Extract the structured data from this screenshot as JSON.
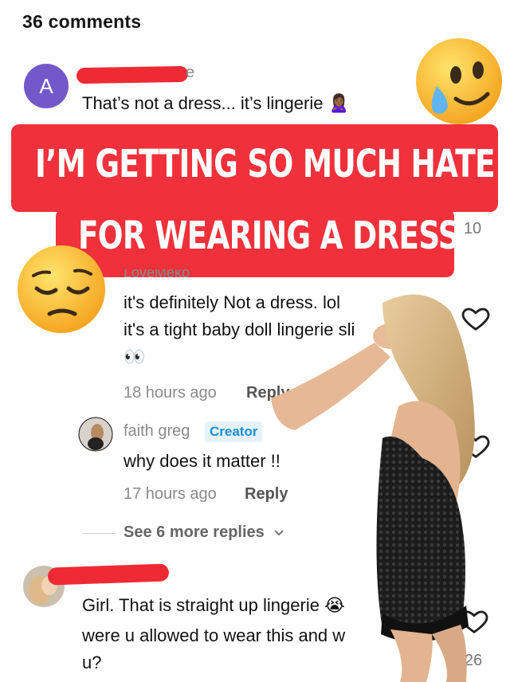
{
  "header": {
    "comments_count": "36 comments"
  },
  "overlay": {
    "line1": "I’M GETTING SO MUCH HATE",
    "line2": "FOR WEARING A DRESS"
  },
  "comments": [
    {
      "avatar_letter": "A",
      "username_fragment": "e",
      "text": "That’s not a dress... it’s lingerie",
      "emoji": "🙎🏾‍♀️",
      "like_count": "10"
    },
    {
      "username_fragment": "LoveMeko",
      "text_line1": "it's definitely Not a dress. lol",
      "text_line2": "it's a tight baby doll lingerie sli",
      "text_line3": "👀",
      "time": "18 hours ago",
      "reply_label": "Reply"
    },
    {
      "username": "faith greg",
      "badge": "Creator",
      "text": "why does it matter !!",
      "time": "17 hours ago",
      "reply_label": "Reply"
    },
    {
      "text_line1": "Girl. That is straight up lingerie",
      "emoji": "😭",
      "text_line2": "were u allowed to wear this and w",
      "text_line3": "u?",
      "like_count": "26"
    }
  ],
  "see_more": {
    "label": "See 6 more replies"
  },
  "colors": {
    "banner": "#f0313b",
    "redaction": "#ee2b34",
    "avatar": "#7358c9",
    "badge_text": "#1b8fd6"
  },
  "icons": [
    "heart-icon",
    "chevron-down-icon",
    "crying-smile-emoji",
    "pensive-emoji"
  ]
}
